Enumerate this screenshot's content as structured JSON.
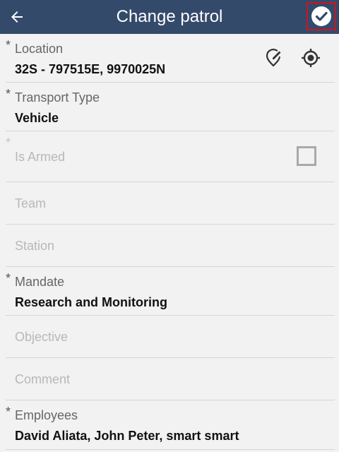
{
  "header": {
    "title": "Change patrol"
  },
  "fields": {
    "location": {
      "label": "Location",
      "value": "32S - 797515E, 9970025N",
      "required": "*"
    },
    "transport": {
      "label": "Transport Type",
      "value": "Vehicle",
      "required": "*"
    },
    "armed": {
      "label": "Is Armed",
      "required": "*",
      "checked": false
    },
    "team": {
      "label": "Team"
    },
    "station": {
      "label": "Station"
    },
    "mandate": {
      "label": "Mandate",
      "value": "Research and Monitoring",
      "required": "*"
    },
    "objective": {
      "label": "Objective"
    },
    "comment": {
      "label": "Comment"
    },
    "employees": {
      "label": "Employees",
      "value": "David Aliata, John Peter, smart smart",
      "required": "*"
    }
  },
  "colors": {
    "appbar": "#344a6b",
    "highlight": "#d0131f",
    "background": "#f2f2f2"
  },
  "icons": [
    "back-arrow-icon",
    "checkmark-circle-icon",
    "edit-location-icon",
    "gps-target-icon",
    "checkbox-icon"
  ]
}
